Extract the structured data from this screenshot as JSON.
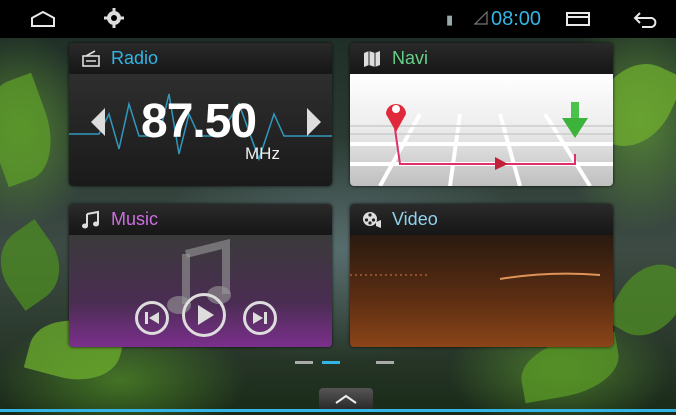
{
  "status_bar": {
    "time": "08:00",
    "time_color": "#33b5e5",
    "icons": [
      "home-icon",
      "gear-icon",
      "bluetooth-icon",
      "signal-icon",
      "recent-apps-icon",
      "back-icon"
    ]
  },
  "tiles": {
    "radio": {
      "label": "Radio",
      "frequency": "87.50",
      "unit": "MHz",
      "accent": "#33b5e5",
      "icon": "radio-icon"
    },
    "navi": {
      "label": "Navi",
      "accent": "#66d088",
      "icon": "map-icon"
    },
    "music": {
      "label": "Music",
      "accent": "#cc6ee0",
      "icon": "music-note-icon"
    },
    "video": {
      "label": "Video",
      "accent": "#8fd4ee",
      "icon": "film-reel-icon"
    }
  },
  "pager": {
    "pages": 3,
    "current": 2
  }
}
